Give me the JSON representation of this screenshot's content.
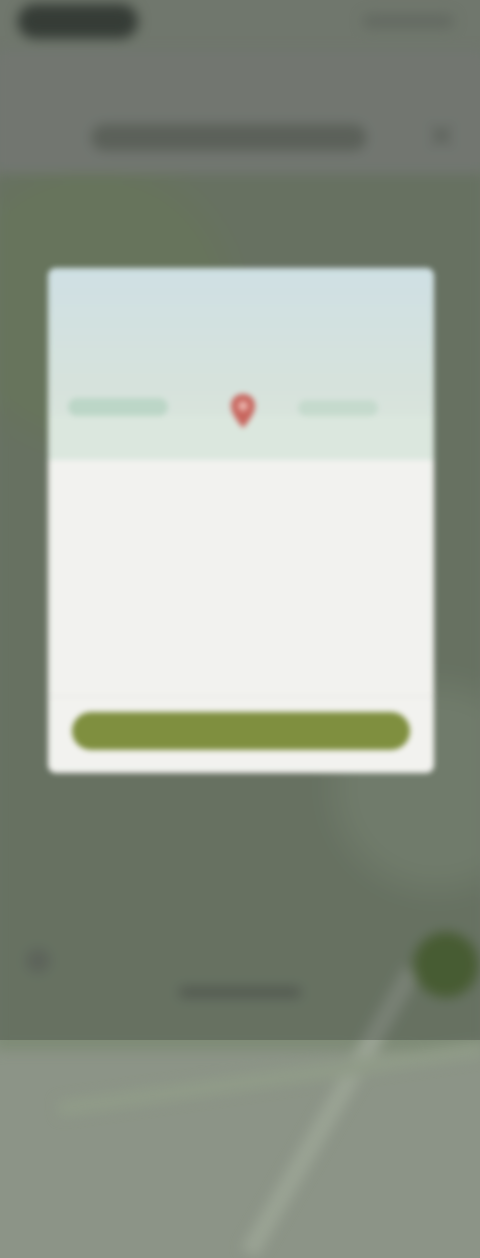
{
  "header": {
    "title": "",
    "tabs": [
      {
        "label": ""
      },
      {
        "label": ""
      }
    ]
  },
  "modal": {
    "title": "",
    "body": "",
    "link_label": "",
    "button_label": ""
  },
  "colors": {
    "accent": "#7f8f3f",
    "fab": "#4e6a2e",
    "modal_bg": "#f2f2ef"
  },
  "icons": {
    "close": "close-icon",
    "pin": "map-pin-icon"
  }
}
